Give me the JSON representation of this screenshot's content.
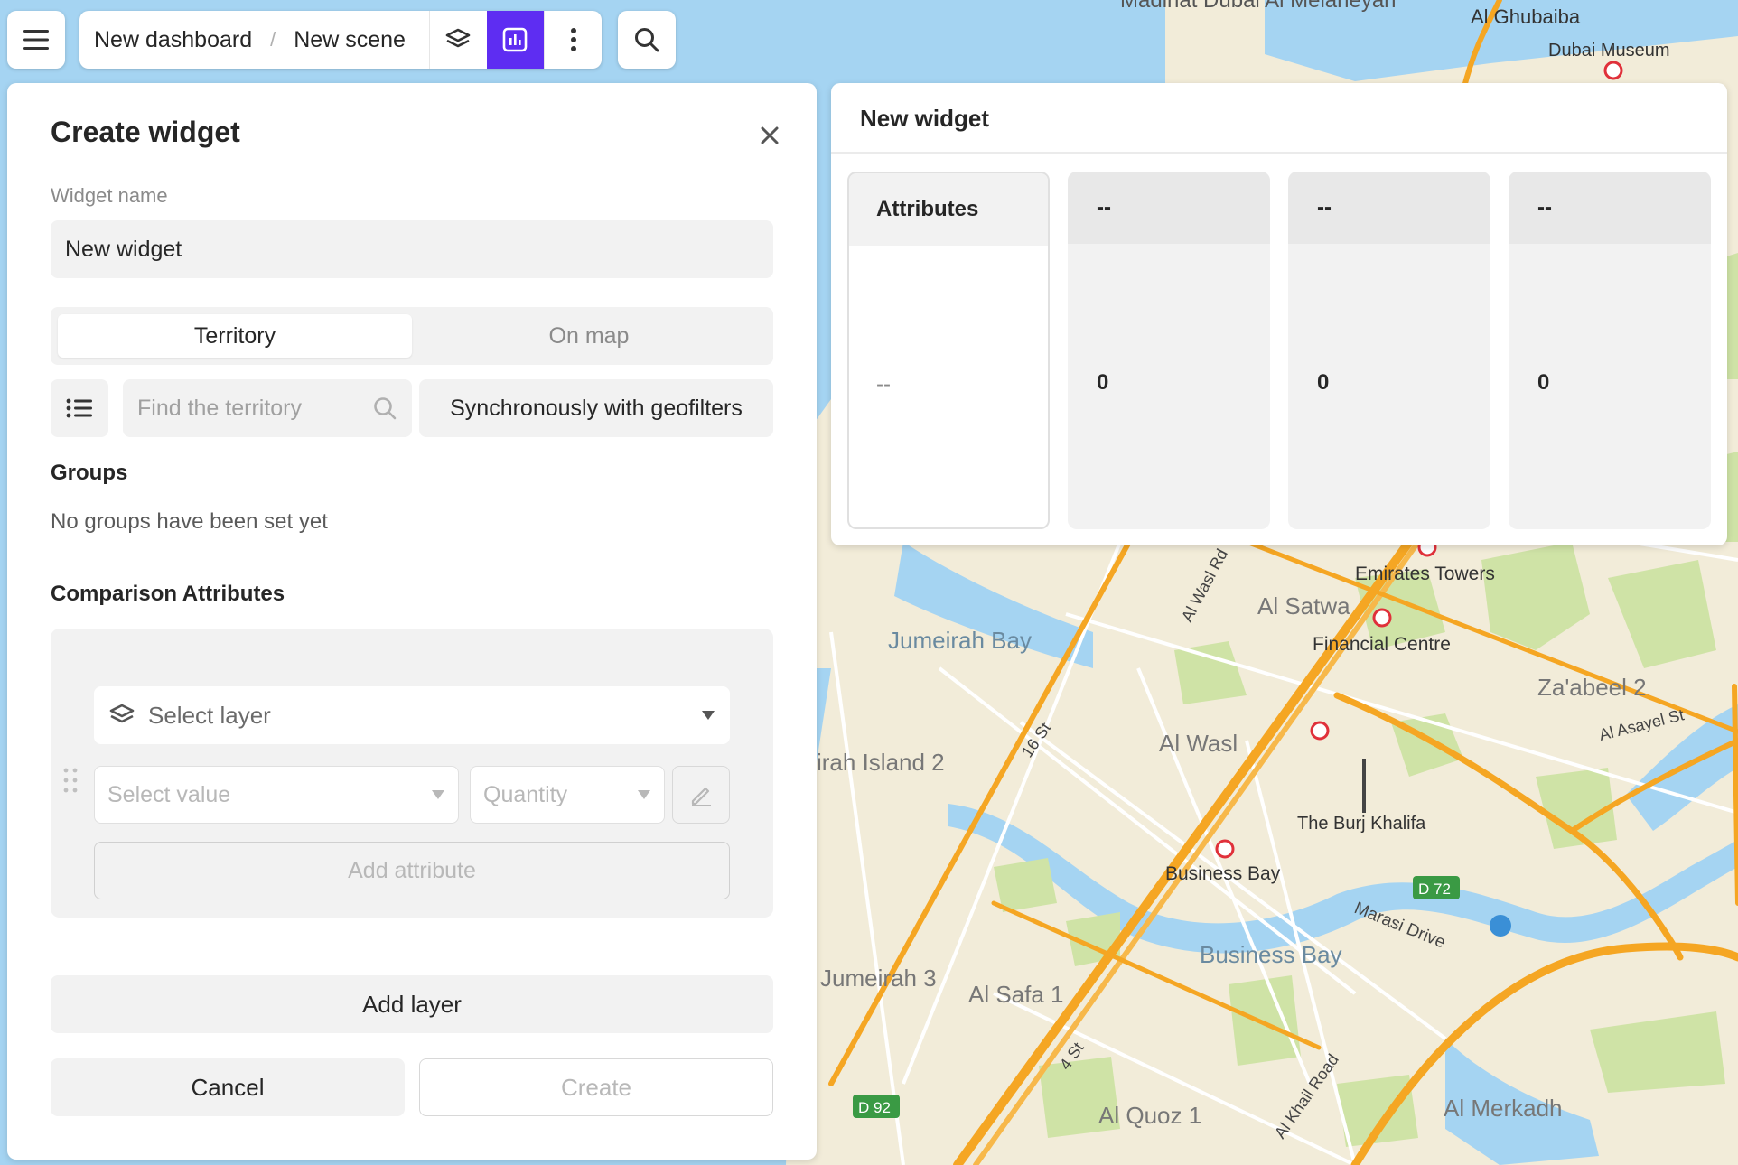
{
  "header": {
    "dashboard": "New dashboard",
    "separator": "/",
    "scene": "New scene",
    "icons": [
      "menu-icon",
      "layers-icon",
      "chart-icon",
      "more-vertical-icon",
      "search-icon"
    ]
  },
  "create_panel": {
    "title": "Create widget",
    "name_label": "Widget name",
    "name_value": "New widget",
    "tabs": [
      {
        "label": "Territory",
        "selected": true
      },
      {
        "label": "On map",
        "selected": false
      }
    ],
    "find_placeholder": "Find the territory",
    "sync_label": "Synchronously with geofilters",
    "groups_title": "Groups",
    "groups_empty": "No groups have been set yet",
    "comparison_title": "Comparison Attributes",
    "select_layer": "Select layer",
    "select_value": "Select value",
    "quantity": "Quantity",
    "add_attribute": "Add attribute",
    "add_layer": "Add layer",
    "cancel": "Cancel",
    "create": "Create"
  },
  "preview": {
    "title": "New widget",
    "columns": [
      {
        "header": "Attributes",
        "value": "--"
      },
      {
        "header": "--",
        "value": "0"
      },
      {
        "header": "--",
        "value": "0"
      },
      {
        "header": "--",
        "value": "0"
      }
    ]
  },
  "map_labels": {
    "top_partial": "Madinat Dubai Al Melaheyah",
    "al_ghubaiba": "Al Ghubaiba",
    "dubai_museum": "Dubai Museum",
    "emirates_towers": "Emirates Towers",
    "al_satwa": "Al Satwa",
    "financial_centre": "Financial Centre",
    "jumeirah_bay": "Jumeirah Bay",
    "zaabeel2": "Za'abeel 2",
    "al_asayel": "Al Asayel St",
    "al_wasl": "Al Wasl",
    "al_wasl_rd": "Al Wasl Rd",
    "st16": "16 St",
    "jumeirah_island2": "irah Island 2",
    "burj_khalifa": "The Burj Khalifa",
    "business_bay_station": "Business Bay",
    "d72": "D 72",
    "marasi": "Marasi Drive",
    "business_bay": "Business Bay",
    "jumeirah3": "Jumeirah 3",
    "al_safa1": "Al Safa 1",
    "st4": "4 St",
    "d92": "D 92",
    "al_khail": "Al Khail Road",
    "al_quoz1": "Al Quoz 1",
    "al_merkadh": "Al Merkadh"
  },
  "colors": {
    "accent": "#5e2df2",
    "water": "#a5d4f2",
    "land": "#f2ecd9",
    "park": "#cfe3a6",
    "road_major": "#f5a623"
  }
}
